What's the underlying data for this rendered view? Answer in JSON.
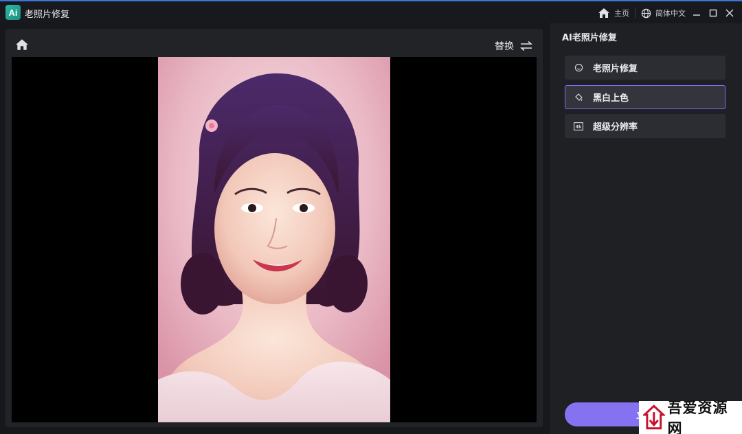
{
  "titlebar": {
    "app_title": "老照片修复",
    "logo_text": "Ai",
    "home_label": "主页",
    "language_label": "简体中文"
  },
  "preview": {
    "replace_label": "替换"
  },
  "sidebar": {
    "title": "AI老照片修复",
    "options": [
      {
        "label": "老照片修复",
        "icon": "face-outline-icon",
        "active": false
      },
      {
        "label": "黑白上色",
        "icon": "paint-bucket-icon",
        "active": true
      },
      {
        "label": "超级分辨率",
        "icon": "4k-icon",
        "active": false
      }
    ],
    "start_button": "立即"
  },
  "watermark": {
    "text": "吾爱资源网"
  },
  "colors": {
    "accent": "#8572f0",
    "active_border": "#7f6ef2",
    "titlebar_top": "#3d76d6"
  }
}
